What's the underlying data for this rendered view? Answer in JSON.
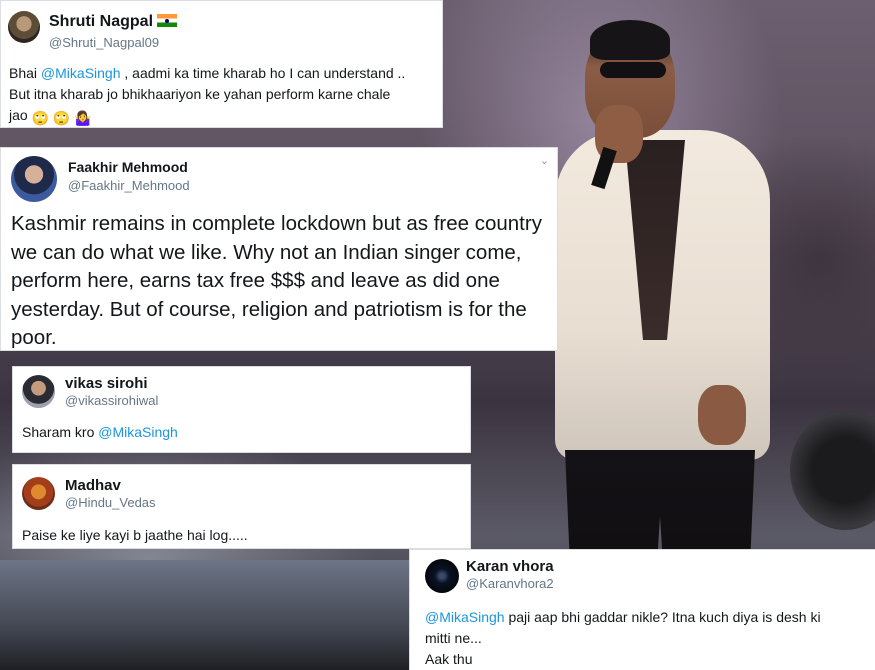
{
  "tweets": {
    "t1": {
      "name": "Shruti Nagpal",
      "handle": "@Shruti_Nagpal09",
      "text_pre": "Bhai ",
      "mention": "@MikaSingh",
      "text_post": " , aadmi ka time kharab ho I can understand ..",
      "line2": "But itna kharab jo bhikhaariyon ke yahan perform karne chale",
      "line3": "jao",
      "emoji": "🙄 🙄 🤷‍♀️"
    },
    "t2": {
      "name": "Faakhir Mehmood",
      "handle": "@Faakhir_Mehmood",
      "chevron": "⌄",
      "text": "Kashmir remains in complete lockdown but as free country we can do what we like. Why not an Indian singer come, perform here, earns tax free $$$ and leave as did one yesterday. But of course, religion and patriotism is for the poor."
    },
    "t3": {
      "name": "vikas sirohi",
      "handle": "@vikassirohiwal",
      "text_pre": "Sharam kro ",
      "mention": "@MikaSingh"
    },
    "t4": {
      "name": "Madhav",
      "handle": "@Hindu_Vedas",
      "text": "Paise ke liye kayi b jaathe hai log....."
    },
    "t5": {
      "name": "Karan vhora",
      "handle": "@Karanvhora2",
      "mention": "@MikaSingh",
      "text_post": " paji aap bhi gaddar nikle? Itna kuch diya is desh ki",
      "line2": "mitti ne...",
      "line3": "Aak thu"
    }
  },
  "colors": {
    "mention": "#1b95e0",
    "name": "#14171a",
    "handle": "#657786"
  }
}
